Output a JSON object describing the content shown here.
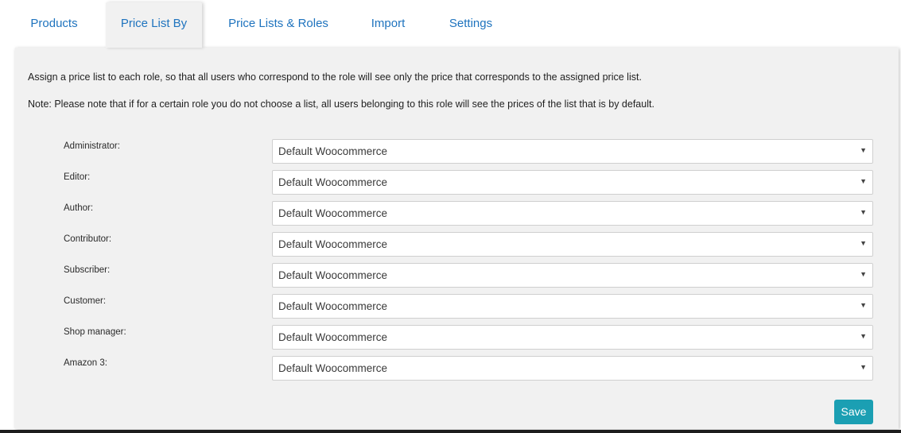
{
  "tabs": {
    "products": "Products",
    "price_list_by": "Price List By",
    "price_lists_roles": "Price Lists & Roles",
    "import": "Import",
    "settings": "Settings"
  },
  "intro": {
    "line1": "Assign a price list to each role, so that all users who correspond to the role will see only the price that corresponds to the assigned price list.",
    "line2": "Note: Please note that if for a certain role you do not choose a list, all users belonging to this role will see the prices of the list that is by default."
  },
  "roles": [
    {
      "label": "Administrator:",
      "value": "Default Woocommerce"
    },
    {
      "label": "Editor:",
      "value": "Default Woocommerce"
    },
    {
      "label": "Author:",
      "value": "Default Woocommerce"
    },
    {
      "label": "Contributor:",
      "value": "Default Woocommerce"
    },
    {
      "label": "Subscriber:",
      "value": "Default Woocommerce"
    },
    {
      "label": "Customer:",
      "value": "Default Woocommerce"
    },
    {
      "label": "Shop manager:",
      "value": "Default Woocommerce"
    },
    {
      "label": "Amazon 3:",
      "value": "Default Woocommerce"
    }
  ],
  "select_caret": "▼",
  "save_label": "Save",
  "colors": {
    "tab_link": "#1e73be",
    "save_button": "#1b9fb3",
    "panel_bg": "#f1f1f1"
  }
}
